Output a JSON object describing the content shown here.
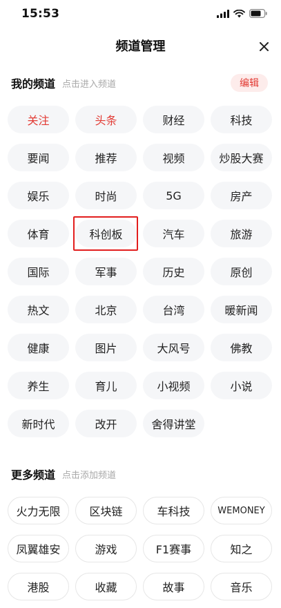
{
  "status": {
    "time": "15:53"
  },
  "header": {
    "title": "频道管理",
    "close_icon": "close-icon"
  },
  "my_channels": {
    "title": "我的频道",
    "hint": "点击进入频道",
    "edit_label": "编辑",
    "items": [
      {
        "label": "关注",
        "active": true
      },
      {
        "label": "头条",
        "active": true
      },
      {
        "label": "财经"
      },
      {
        "label": "科技"
      },
      {
        "label": "要闻"
      },
      {
        "label": "推荐"
      },
      {
        "label": "视频"
      },
      {
        "label": "炒股大赛"
      },
      {
        "label": "娱乐"
      },
      {
        "label": "时尚"
      },
      {
        "label": "5G"
      },
      {
        "label": "房产"
      },
      {
        "label": "体育"
      },
      {
        "label": "科创板",
        "highlighted": true
      },
      {
        "label": "汽车"
      },
      {
        "label": "旅游"
      },
      {
        "label": "国际"
      },
      {
        "label": "军事"
      },
      {
        "label": "历史"
      },
      {
        "label": "原创"
      },
      {
        "label": "热文"
      },
      {
        "label": "北京"
      },
      {
        "label": "台湾"
      },
      {
        "label": "暖新闻"
      },
      {
        "label": "健康"
      },
      {
        "label": "图片"
      },
      {
        "label": "大风号"
      },
      {
        "label": "佛教"
      },
      {
        "label": "养生"
      },
      {
        "label": "育儿"
      },
      {
        "label": "小视频"
      },
      {
        "label": "小说"
      },
      {
        "label": "新时代"
      },
      {
        "label": "改开"
      },
      {
        "label": "舍得讲堂"
      }
    ]
  },
  "more_channels": {
    "title": "更多频道",
    "hint": "点击添加频道",
    "items": [
      {
        "label": "火力无限"
      },
      {
        "label": "区块链"
      },
      {
        "label": "车科技"
      },
      {
        "label": "WEMONEY"
      },
      {
        "label": "凤翼雄安"
      },
      {
        "label": "游戏"
      },
      {
        "label": "F1赛事"
      },
      {
        "label": "知之"
      },
      {
        "label": "港股"
      },
      {
        "label": "收藏"
      },
      {
        "label": "故事"
      },
      {
        "label": "音乐"
      }
    ]
  },
  "colors": {
    "accent": "#e23a33",
    "chip_bg": "#f5f6f8",
    "highlight_border": "#e21d1d"
  }
}
